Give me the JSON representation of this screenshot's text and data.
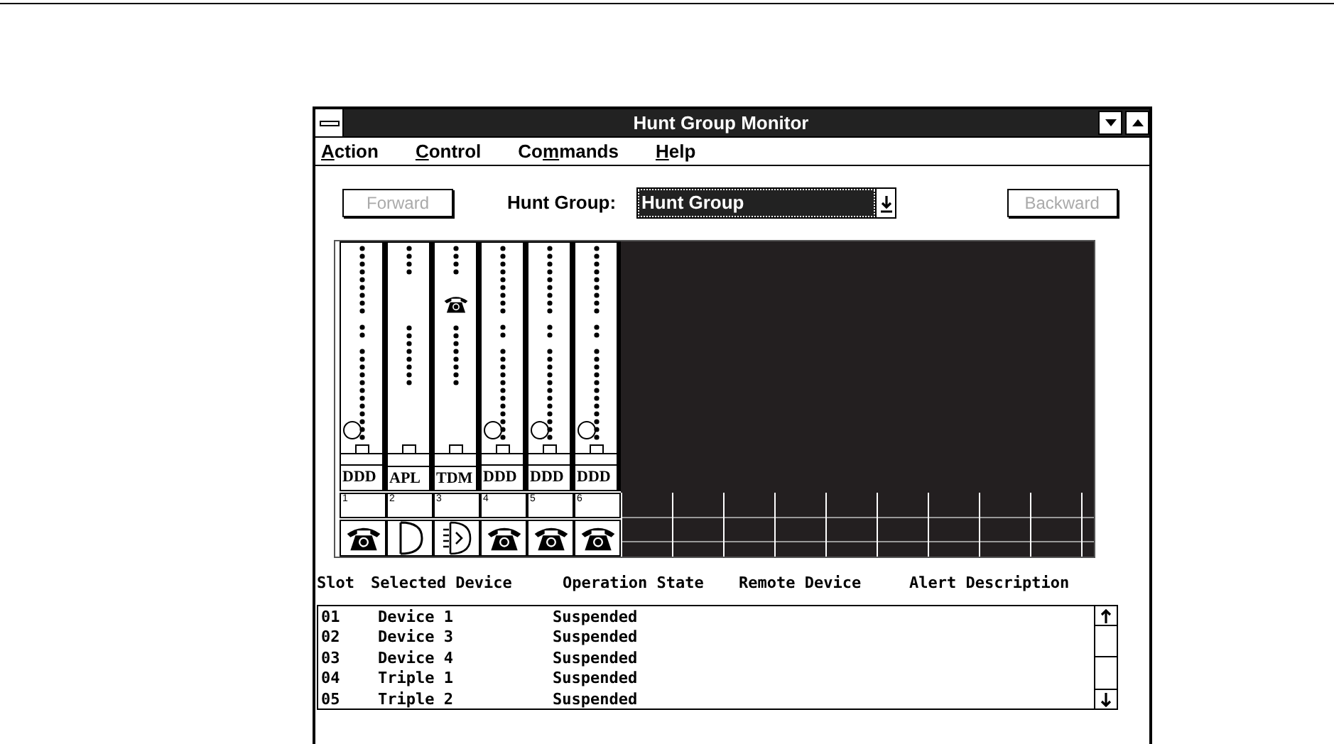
{
  "window": {
    "title": "Hunt Group Monitor"
  },
  "menu": [
    {
      "key": "A",
      "rest": "ction"
    },
    {
      "key": "C",
      "rest": "ontrol"
    },
    {
      "lead": "Co",
      "key": "m",
      "rest": "mands"
    },
    {
      "key": "H",
      "rest": "elp"
    }
  ],
  "toolbar": {
    "forward": {
      "label": "Forward",
      "disabled": true
    },
    "hunt_group_label": "Hunt Group:",
    "hunt_group": {
      "value": "Hunt Group"
    },
    "backward": {
      "label": "Backward",
      "disabled": true
    }
  },
  "cards": [
    {
      "label": "DDD",
      "slot": "1",
      "lamp_on": true,
      "in_use": false,
      "kind": "phone"
    },
    {
      "label": "APL",
      "slot": "2",
      "lamp_on": false,
      "in_use": false,
      "kind": "apl"
    },
    {
      "label": "TDM",
      "slot": "3",
      "lamp_on": false,
      "in_use": true,
      "kind": "tdm"
    },
    {
      "label": "DDD",
      "slot": "4",
      "lamp_on": true,
      "in_use": false,
      "kind": "phone"
    },
    {
      "label": "DDD",
      "slot": "5",
      "lamp_on": true,
      "in_use": false,
      "kind": "phone"
    },
    {
      "label": "DDD",
      "slot": "6",
      "lamp_on": true,
      "in_use": false,
      "kind": "phone"
    }
  ],
  "table": {
    "columns": [
      "Slot",
      "Selected Device",
      "Operation State",
      "Remote Device",
      "Alert Description"
    ],
    "rows": [
      {
        "slot": "01",
        "device": "Device 1",
        "state": "Suspended"
      },
      {
        "slot": "02",
        "device": "Device 3",
        "state": "Suspended"
      },
      {
        "slot": "03",
        "device": "Device 4",
        "state": "Suspended"
      },
      {
        "slot": "04",
        "device": "Triple 1",
        "state": "Suspended"
      },
      {
        "slot": "05",
        "device": "Triple 2",
        "state": "Suspended"
      }
    ]
  }
}
